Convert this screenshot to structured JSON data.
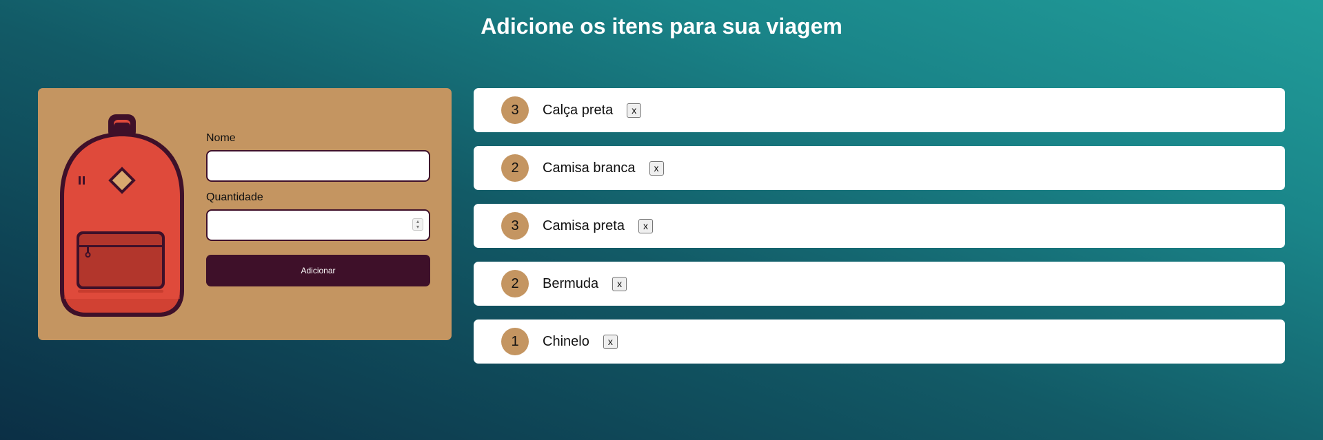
{
  "header": {
    "title": "Adicione os itens para sua viagem"
  },
  "form": {
    "name_label": "Nome",
    "name_value": "",
    "quantity_label": "Quantidade",
    "quantity_value": "",
    "submit_label": "Adicionar"
  },
  "items": [
    {
      "quantity": "3",
      "name": "Calça preta",
      "remove_label": "x"
    },
    {
      "quantity": "2",
      "name": "Camisa branca",
      "remove_label": "x"
    },
    {
      "quantity": "3",
      "name": "Camisa preta",
      "remove_label": "x"
    },
    {
      "quantity": "2",
      "name": "Bermuda",
      "remove_label": "x"
    },
    {
      "quantity": "1",
      "name": "Chinelo",
      "remove_label": "x"
    }
  ],
  "colors": {
    "card": "#c49561",
    "button": "#3e1029",
    "backpack": "#df4a3b",
    "badge": "#c49561"
  },
  "icons": {
    "illustration": "backpack-icon"
  }
}
